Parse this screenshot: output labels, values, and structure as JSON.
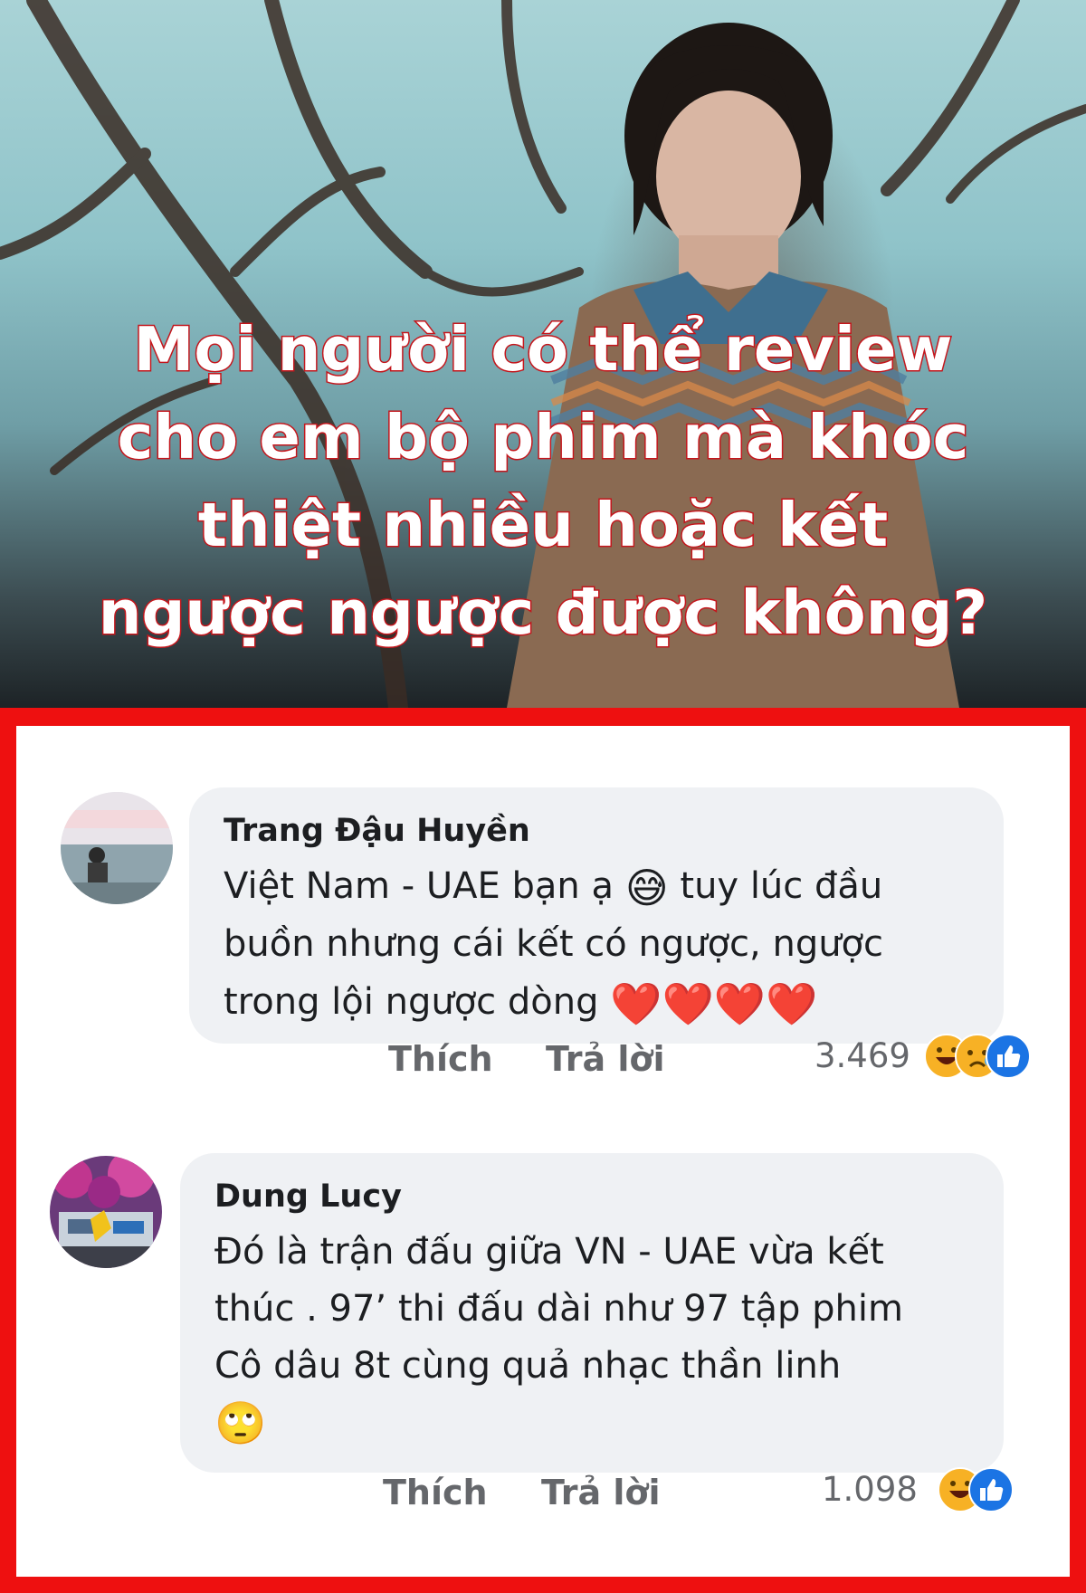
{
  "hero": {
    "headline_lines": [
      "Mọi người có thể review",
      "cho em bộ phim mà khóc",
      "thiệt nhiều hoặc kết",
      "ngược ngược được không?"
    ],
    "colors": {
      "headline_fill": "#ffffff",
      "headline_outline": "#c4161c"
    }
  },
  "frame": {
    "border_color": "#ee1010"
  },
  "comments": [
    {
      "author": "Trang Đậu Huyền",
      "lines": [
        "Việt Nam - UAE bạn ạ",
        "tuy lúc đầu",
        "buồn nhưng cái kết có ngược, ngược",
        "trong lội ngược dòng"
      ],
      "emoji_inline": "😅",
      "emoji_trailing": "❤️❤️❤️❤️",
      "actions": {
        "like": "Thích",
        "reply": "Trả lời"
      },
      "reaction_count": "3.469",
      "reaction_icons": [
        "haha-icon",
        "sad-icon",
        "like-icon"
      ]
    },
    {
      "author": "Dung Lucy",
      "lines": [
        "Đó là trận đấu giữa VN - UAE  vừa kết",
        "thúc . 97’ thi đấu dài như 97 tập phim",
        "Cô dâu 8t cùng quả nhạc thần linh"
      ],
      "emoji_trailing": "🙄",
      "actions": {
        "like": "Thích",
        "reply": "Trả lời"
      },
      "reaction_count": "1.098",
      "reaction_icons": [
        "haha-icon",
        "like-icon"
      ]
    }
  ]
}
